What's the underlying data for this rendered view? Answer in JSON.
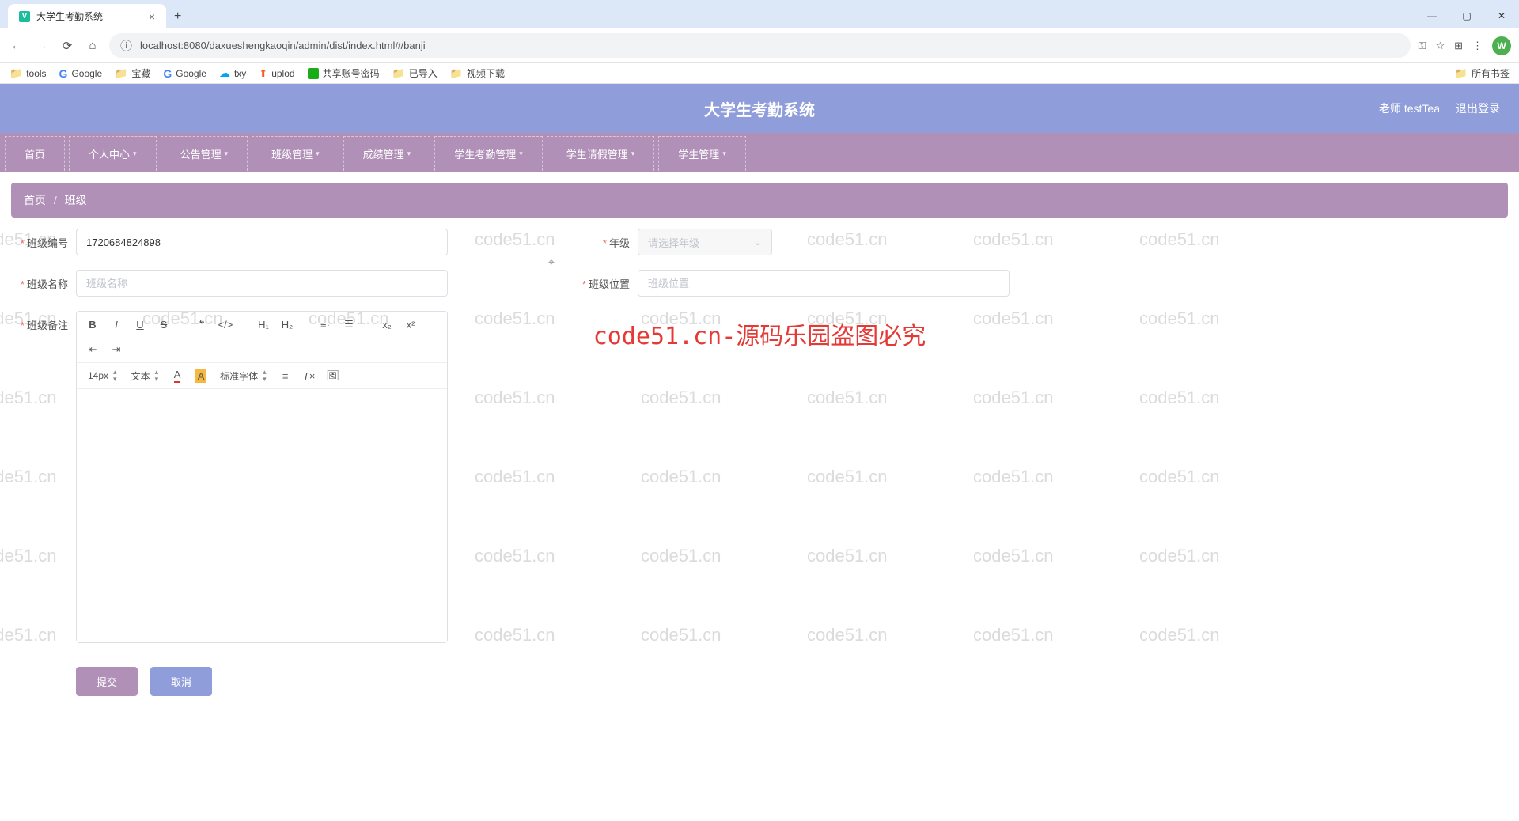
{
  "browser": {
    "tab_title": "大学生考勤系统",
    "url": "localhost:8080/daxueshengkaoqin/admin/dist/index.html#/banji",
    "avatar_letter": "W",
    "bookmarks": [
      "tools",
      "Google",
      "宝藏",
      "Google",
      "txy",
      "uplod",
      "共享账号密码",
      "已导入",
      "视频下载"
    ],
    "all_bookmarks": "所有书签"
  },
  "header": {
    "title": "大学生考勤系统",
    "user": "老师 testTea",
    "logout": "退出登录"
  },
  "nav": {
    "items": [
      {
        "label": "首页",
        "caret": false
      },
      {
        "label": "个人中心",
        "caret": true
      },
      {
        "label": "公告管理",
        "caret": true
      },
      {
        "label": "班级管理",
        "caret": true
      },
      {
        "label": "成绩管理",
        "caret": true
      },
      {
        "label": "学生考勤管理",
        "caret": true
      },
      {
        "label": "学生请假管理",
        "caret": true
      },
      {
        "label": "学生管理",
        "caret": true
      }
    ]
  },
  "breadcrumb": {
    "home": "首页",
    "sep": "/",
    "current": "班级"
  },
  "form": {
    "class_id_label": "班级编号",
    "class_id_value": "1720684824898",
    "grade_label": "年级",
    "grade_placeholder": "请选择年级",
    "class_name_label": "班级名称",
    "class_name_placeholder": "班级名称",
    "class_loc_label": "班级位置",
    "class_loc_placeholder": "班级位置",
    "class_note_label": "班级备注"
  },
  "editor": {
    "font_size": "14px",
    "style": "文本",
    "font_family": "标准字体"
  },
  "buttons": {
    "submit": "提交",
    "cancel": "取消"
  },
  "watermark": {
    "repeat": "code51.cn",
    "center": "code51.cn-源码乐园盗图必究"
  }
}
